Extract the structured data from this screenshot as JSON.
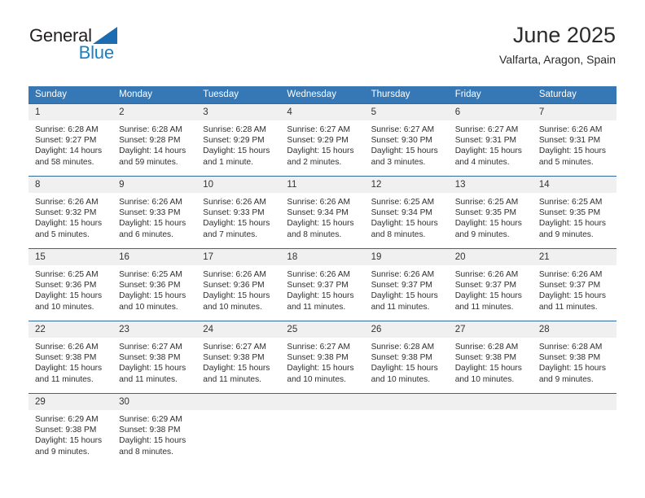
{
  "brand": {
    "line1": "General",
    "line2": "Blue",
    "logo_icon": "triangle-logo-icon",
    "accent_color": "#1b7fc4"
  },
  "header": {
    "title": "June 2025",
    "location": "Valfarta, Aragon, Spain"
  },
  "theme": {
    "header_bg": "#3578b5",
    "row_border": "#31699f",
    "daynum_bg": "#f0f0f0",
    "text": "#2f2f2f"
  },
  "calendar": {
    "weekday_headers": [
      "Sunday",
      "Monday",
      "Tuesday",
      "Wednesday",
      "Thursday",
      "Friday",
      "Saturday"
    ],
    "weeks": [
      [
        {
          "day": "1",
          "sunrise": "Sunrise: 6:28 AM",
          "sunset": "Sunset: 9:27 PM",
          "daylight": "Daylight: 14 hours and 58 minutes."
        },
        {
          "day": "2",
          "sunrise": "Sunrise: 6:28 AM",
          "sunset": "Sunset: 9:28 PM",
          "daylight": "Daylight: 14 hours and 59 minutes."
        },
        {
          "day": "3",
          "sunrise": "Sunrise: 6:28 AM",
          "sunset": "Sunset: 9:29 PM",
          "daylight": "Daylight: 15 hours and 1 minute."
        },
        {
          "day": "4",
          "sunrise": "Sunrise: 6:27 AM",
          "sunset": "Sunset: 9:29 PM",
          "daylight": "Daylight: 15 hours and 2 minutes."
        },
        {
          "day": "5",
          "sunrise": "Sunrise: 6:27 AM",
          "sunset": "Sunset: 9:30 PM",
          "daylight": "Daylight: 15 hours and 3 minutes."
        },
        {
          "day": "6",
          "sunrise": "Sunrise: 6:27 AM",
          "sunset": "Sunset: 9:31 PM",
          "daylight": "Daylight: 15 hours and 4 minutes."
        },
        {
          "day": "7",
          "sunrise": "Sunrise: 6:26 AM",
          "sunset": "Sunset: 9:31 PM",
          "daylight": "Daylight: 15 hours and 5 minutes."
        }
      ],
      [
        {
          "day": "8",
          "sunrise": "Sunrise: 6:26 AM",
          "sunset": "Sunset: 9:32 PM",
          "daylight": "Daylight: 15 hours and 5 minutes."
        },
        {
          "day": "9",
          "sunrise": "Sunrise: 6:26 AM",
          "sunset": "Sunset: 9:33 PM",
          "daylight": "Daylight: 15 hours and 6 minutes."
        },
        {
          "day": "10",
          "sunrise": "Sunrise: 6:26 AM",
          "sunset": "Sunset: 9:33 PM",
          "daylight": "Daylight: 15 hours and 7 minutes."
        },
        {
          "day": "11",
          "sunrise": "Sunrise: 6:26 AM",
          "sunset": "Sunset: 9:34 PM",
          "daylight": "Daylight: 15 hours and 8 minutes."
        },
        {
          "day": "12",
          "sunrise": "Sunrise: 6:25 AM",
          "sunset": "Sunset: 9:34 PM",
          "daylight": "Daylight: 15 hours and 8 minutes."
        },
        {
          "day": "13",
          "sunrise": "Sunrise: 6:25 AM",
          "sunset": "Sunset: 9:35 PM",
          "daylight": "Daylight: 15 hours and 9 minutes."
        },
        {
          "day": "14",
          "sunrise": "Sunrise: 6:25 AM",
          "sunset": "Sunset: 9:35 PM",
          "daylight": "Daylight: 15 hours and 9 minutes."
        }
      ],
      [
        {
          "day": "15",
          "sunrise": "Sunrise: 6:25 AM",
          "sunset": "Sunset: 9:36 PM",
          "daylight": "Daylight: 15 hours and 10 minutes."
        },
        {
          "day": "16",
          "sunrise": "Sunrise: 6:25 AM",
          "sunset": "Sunset: 9:36 PM",
          "daylight": "Daylight: 15 hours and 10 minutes."
        },
        {
          "day": "17",
          "sunrise": "Sunrise: 6:26 AM",
          "sunset": "Sunset: 9:36 PM",
          "daylight": "Daylight: 15 hours and 10 minutes."
        },
        {
          "day": "18",
          "sunrise": "Sunrise: 6:26 AM",
          "sunset": "Sunset: 9:37 PM",
          "daylight": "Daylight: 15 hours and 11 minutes."
        },
        {
          "day": "19",
          "sunrise": "Sunrise: 6:26 AM",
          "sunset": "Sunset: 9:37 PM",
          "daylight": "Daylight: 15 hours and 11 minutes."
        },
        {
          "day": "20",
          "sunrise": "Sunrise: 6:26 AM",
          "sunset": "Sunset: 9:37 PM",
          "daylight": "Daylight: 15 hours and 11 minutes."
        },
        {
          "day": "21",
          "sunrise": "Sunrise: 6:26 AM",
          "sunset": "Sunset: 9:37 PM",
          "daylight": "Daylight: 15 hours and 11 minutes."
        }
      ],
      [
        {
          "day": "22",
          "sunrise": "Sunrise: 6:26 AM",
          "sunset": "Sunset: 9:38 PM",
          "daylight": "Daylight: 15 hours and 11 minutes."
        },
        {
          "day": "23",
          "sunrise": "Sunrise: 6:27 AM",
          "sunset": "Sunset: 9:38 PM",
          "daylight": "Daylight: 15 hours and 11 minutes."
        },
        {
          "day": "24",
          "sunrise": "Sunrise: 6:27 AM",
          "sunset": "Sunset: 9:38 PM",
          "daylight": "Daylight: 15 hours and 11 minutes."
        },
        {
          "day": "25",
          "sunrise": "Sunrise: 6:27 AM",
          "sunset": "Sunset: 9:38 PM",
          "daylight": "Daylight: 15 hours and 10 minutes."
        },
        {
          "day": "26",
          "sunrise": "Sunrise: 6:28 AM",
          "sunset": "Sunset: 9:38 PM",
          "daylight": "Daylight: 15 hours and 10 minutes."
        },
        {
          "day": "27",
          "sunrise": "Sunrise: 6:28 AM",
          "sunset": "Sunset: 9:38 PM",
          "daylight": "Daylight: 15 hours and 10 minutes."
        },
        {
          "day": "28",
          "sunrise": "Sunrise: 6:28 AM",
          "sunset": "Sunset: 9:38 PM",
          "daylight": "Daylight: 15 hours and 9 minutes."
        }
      ],
      [
        {
          "day": "29",
          "sunrise": "Sunrise: 6:29 AM",
          "sunset": "Sunset: 9:38 PM",
          "daylight": "Daylight: 15 hours and 9 minutes."
        },
        {
          "day": "30",
          "sunrise": "Sunrise: 6:29 AM",
          "sunset": "Sunset: 9:38 PM",
          "daylight": "Daylight: 15 hours and 8 minutes."
        },
        {
          "day": "",
          "sunrise": "",
          "sunset": "",
          "daylight": ""
        },
        {
          "day": "",
          "sunrise": "",
          "sunset": "",
          "daylight": ""
        },
        {
          "day": "",
          "sunrise": "",
          "sunset": "",
          "daylight": ""
        },
        {
          "day": "",
          "sunrise": "",
          "sunset": "",
          "daylight": ""
        },
        {
          "day": "",
          "sunrise": "",
          "sunset": "",
          "daylight": ""
        }
      ]
    ]
  }
}
